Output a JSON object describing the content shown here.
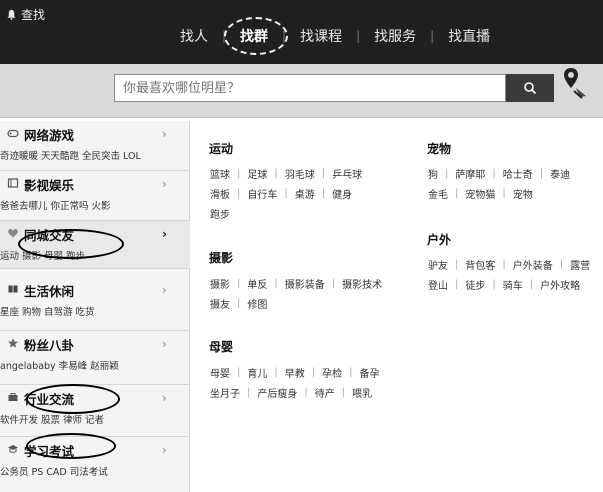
{
  "brand": {
    "label": "查找"
  },
  "nav": [
    {
      "label": "找人",
      "active": false
    },
    {
      "label": "找群",
      "active": true
    },
    {
      "label": "找课程",
      "active": false
    },
    {
      "label": "找服务",
      "active": false
    },
    {
      "label": "找直播",
      "active": false
    }
  ],
  "search": {
    "placeholder": "你最喜欢哪位明星？",
    "button_icon": "search-icon",
    "location_icon": "location-pin-icon"
  },
  "sidebar": [
    {
      "title": "网络游戏",
      "sub": "奇迹暖暖 天天酷跑 全民突击 LOL",
      "icon": "gamepad-icon"
    },
    {
      "title": "影视娱乐",
      "sub": "爸爸去哪儿 你正常吗 火影",
      "icon": "film-icon"
    },
    {
      "title": "同城交友",
      "sub": "运动 摄影 母婴 跑步",
      "icon": "heart-icon"
    },
    {
      "title": "生活休闲",
      "sub": "星座 购物 自驾游 吃货",
      "icon": "book-icon"
    },
    {
      "title": "粉丝八卦",
      "sub": "angelababy 李易峰 赵丽颖",
      "icon": "star-icon"
    },
    {
      "title": "行业交流",
      "sub": "软件开发 股票 律师 记者",
      "icon": "briefcase-icon"
    },
    {
      "title": "学习考试",
      "sub": "公务员 PS CAD 司法考试",
      "icon": "graduation-icon"
    }
  ],
  "sections": {
    "sport": {
      "title": "运动",
      "rows": [
        [
          "篮球",
          "足球",
          "羽毛球",
          "乒乓球"
        ],
        [
          "滑板",
          "自行车",
          "桌游",
          "健身"
        ],
        [
          "跑步"
        ]
      ]
    },
    "pets": {
      "title": "宠物",
      "rows": [
        [
          "狗",
          "萨摩耶",
          "哈士奇",
          "泰迪"
        ],
        [
          "金毛",
          "宠物猫",
          "宠物"
        ]
      ]
    },
    "outdoor": {
      "title": "户外",
      "rows": [
        [
          "驴友",
          "背包客",
          "户外装备",
          "露营"
        ],
        [
          "登山",
          "徒步",
          "骑车",
          "户外攻略"
        ]
      ]
    },
    "photo": {
      "title": "摄影",
      "rows": [
        [
          "摄影",
          "单反",
          "摄影装备",
          "摄影技术"
        ],
        [
          "摄友",
          "修图"
        ]
      ]
    },
    "baby": {
      "title": "母婴",
      "rows": [
        [
          "母婴",
          "育儿",
          "早教",
          "孕检",
          "备孕"
        ],
        [
          "坐月子",
          "产后瘦身",
          "待产",
          "喂乳"
        ]
      ]
    }
  }
}
